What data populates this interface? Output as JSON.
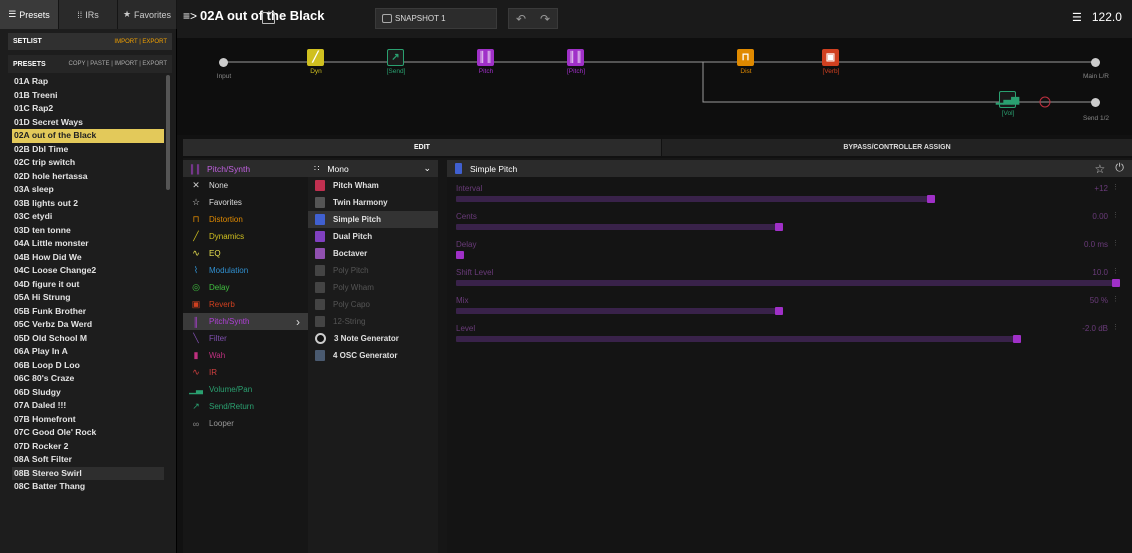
{
  "left_tabs": [
    {
      "icon": "list-icon",
      "glyph": "☰",
      "label": "Presets"
    },
    {
      "icon": "waveform-icon",
      "glyph": "⁞⁞",
      "label": "IRs"
    },
    {
      "icon": "star-icon",
      "glyph": "★",
      "label": "Favorites"
    }
  ],
  "setlist": {
    "label": "SETLIST",
    "actions": "IMPORT | EXPORT"
  },
  "presets_header": {
    "label": "PRESETS",
    "actions": "COPY | PASTE | IMPORT | EXPORT"
  },
  "presets": [
    "01A Rap",
    "01B Treeni",
    "01C Rap2",
    "01D Secret Ways",
    "02A out of the Black",
    "02B Dbl Time",
    "02C trip switch",
    "02D hole hertassa",
    "03A sleep",
    "03B lights out 2",
    "03C etydi",
    "03D ten tonne",
    "04A Little monster",
    "04B How Did We",
    "04C Loose Change2",
    "04D figure it out",
    "05A Hi Strung",
    "05B Funk Brother",
    "05C Verbz Da Werd",
    "05D Old School M",
    "06A Play In A",
    "06B Loop D Loo",
    "06C 80's Craze",
    "06D Sludgy",
    "07A Daled !!!",
    "07B Homefront",
    "07C Good Ole' Rock",
    "07D Rocker 2",
    "08A Soft Filter",
    "08B Stereo Swirl",
    "08C Batter Thang"
  ],
  "selected_preset": "02A out of the Black",
  "topbar": {
    "preset_icon": "≡>",
    "preset_name": "02A out of the Black",
    "snapshot": "SNAPSHOT 1",
    "undo": "↶",
    "redo": "↷",
    "tempo_icon": "☰",
    "tempo": "122.0"
  },
  "chain": {
    "input": "Input",
    "main_out": "Main L/R",
    "send_out": "Send 1/2",
    "blocks": [
      {
        "label": "Dyn",
        "color": "#d0c020",
        "glyph": "╱"
      },
      {
        "label": "[Send]",
        "color": "#2aa070",
        "glyph": "↗"
      },
      {
        "label": "Pitch",
        "color": "#a030c8",
        "glyph": "║║"
      },
      {
        "label": "[Pitch]",
        "color": "#a030c8",
        "glyph": "║║"
      },
      {
        "label": "Dist",
        "color": "#e08a00",
        "glyph": "⊓"
      },
      {
        "label": "[Verb]",
        "color": "#d04020",
        "glyph": "▣"
      },
      {
        "label": "[Vol]",
        "color": "#2aa070",
        "glyph": "▁▃▅"
      }
    ]
  },
  "tabs": {
    "edit": "EDIT",
    "bypass": "BYPASS/CONTROLLER ASSIGN"
  },
  "category_header": "Pitch/Synth",
  "categories": [
    {
      "label": "None",
      "glyph": "✕",
      "color": "#cccccc"
    },
    {
      "label": "Favorites",
      "glyph": "☆",
      "color": "#cccccc"
    },
    {
      "label": "Distortion",
      "glyph": "⊓",
      "color": "#e08a00"
    },
    {
      "label": "Dynamics",
      "glyph": "╱",
      "color": "#d0c020"
    },
    {
      "label": "EQ",
      "glyph": "∿",
      "color": "#e8e050"
    },
    {
      "label": "Modulation",
      "glyph": "⌇",
      "color": "#3090d0"
    },
    {
      "label": "Delay",
      "glyph": "◎",
      "color": "#40c040"
    },
    {
      "label": "Reverb",
      "glyph": "▣",
      "color": "#d04020"
    },
    {
      "label": "Pitch/Synth",
      "glyph": "║",
      "color": "#b040d8"
    },
    {
      "label": "Filter",
      "glyph": "╲",
      "color": "#8050b0"
    },
    {
      "label": "Wah",
      "glyph": "▮",
      "color": "#c03080"
    },
    {
      "label": "IR",
      "glyph": "∿",
      "color": "#d04040"
    },
    {
      "label": "Volume/Pan",
      "glyph": "▁▃",
      "color": "#2aa070"
    },
    {
      "label": "Send/Return",
      "glyph": "↗",
      "color": "#2aa070"
    },
    {
      "label": "Looper",
      "glyph": "∞",
      "color": "#888888"
    }
  ],
  "selected_category": "Pitch/Synth",
  "mode": "Mono",
  "models": [
    {
      "label": "Pitch Wham",
      "color": "#c03050",
      "enabled": true
    },
    {
      "label": "Twin Harmony",
      "color": "#555555",
      "enabled": true
    },
    {
      "label": "Simple Pitch",
      "color": "#4060d0",
      "enabled": true
    },
    {
      "label": "Dual Pitch",
      "color": "#8040c0",
      "enabled": true
    },
    {
      "label": "Boctaver",
      "color": "#9050b0",
      "enabled": true
    },
    {
      "label": "Poly Pitch",
      "color": "#444444",
      "enabled": false
    },
    {
      "label": "Poly Wham",
      "color": "#444444",
      "enabled": false
    },
    {
      "label": "Poly Capo",
      "color": "#444444",
      "enabled": false
    },
    {
      "label": "12-String",
      "color": "#444444",
      "enabled": false
    },
    {
      "label": "3 Note Generator",
      "color": "#cccccc",
      "enabled": true
    },
    {
      "label": "4 OSC Generator",
      "color": "#4a5a70",
      "enabled": true
    }
  ],
  "selected_model": "Simple Pitch",
  "param_header": "Simple Pitch",
  "params": [
    {
      "name": "Interval",
      "value": "+12",
      "level": 0.72
    },
    {
      "name": "Cents",
      "value": "0.00",
      "level": 0.49
    },
    {
      "name": "Delay",
      "value": "0.0 ms",
      "level": 0.0
    },
    {
      "name": "Shift Level",
      "value": "10.0",
      "level": 1.0
    },
    {
      "name": "Mix",
      "value": "50 %",
      "level": 0.49
    },
    {
      "name": "Level",
      "value": "-2.0 dB",
      "level": 0.85
    }
  ]
}
